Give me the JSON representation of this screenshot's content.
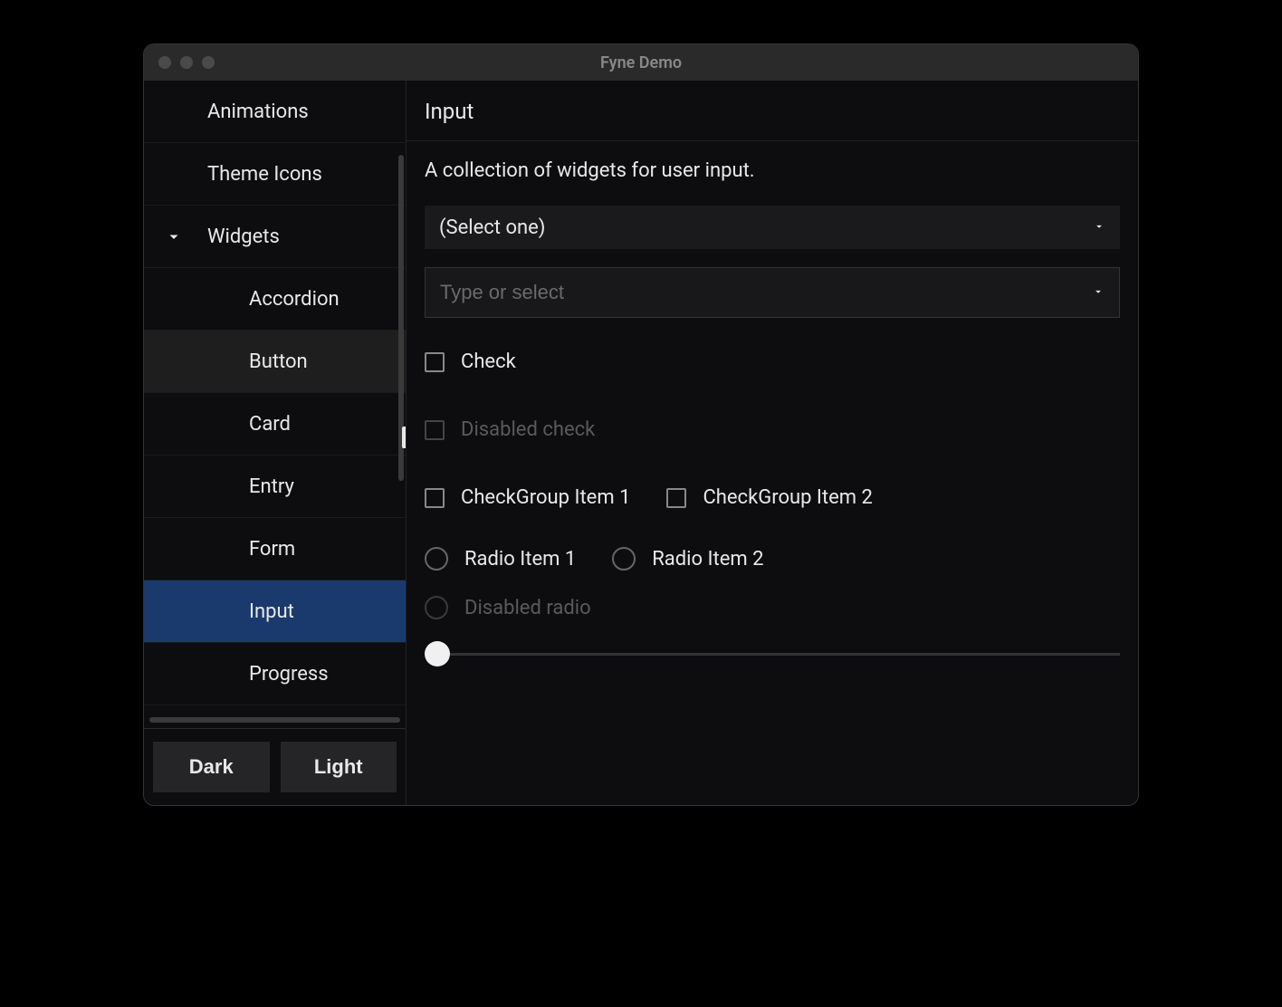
{
  "window": {
    "title": "Fyne Demo"
  },
  "sidebar": {
    "items": [
      {
        "label": "Animations",
        "indent": "parent"
      },
      {
        "label": "Theme Icons",
        "indent": "parent"
      },
      {
        "label": "Widgets",
        "indent": "parent",
        "expanded": true
      },
      {
        "label": "Accordion",
        "indent": "child"
      },
      {
        "label": "Button",
        "indent": "child",
        "hovered": true
      },
      {
        "label": "Card",
        "indent": "child"
      },
      {
        "label": "Entry",
        "indent": "child"
      },
      {
        "label": "Form",
        "indent": "child"
      },
      {
        "label": "Input",
        "indent": "child",
        "selected": true
      },
      {
        "label": "Progress",
        "indent": "child"
      }
    ]
  },
  "theme": {
    "dark": "Dark",
    "light": "Light"
  },
  "main": {
    "title": "Input",
    "description": "A collection of widgets for user input.",
    "select_placeholder": "(Select one)",
    "entry_placeholder": "Type or select",
    "check_label": "Check",
    "disabled_check_label": "Disabled check",
    "checkgroup": {
      "item1": "CheckGroup Item 1",
      "item2": "CheckGroup Item 2"
    },
    "radiogroup": {
      "item1": "Radio Item 1",
      "item2": "Radio Item 2"
    },
    "disabled_radio_label": "Disabled radio"
  }
}
